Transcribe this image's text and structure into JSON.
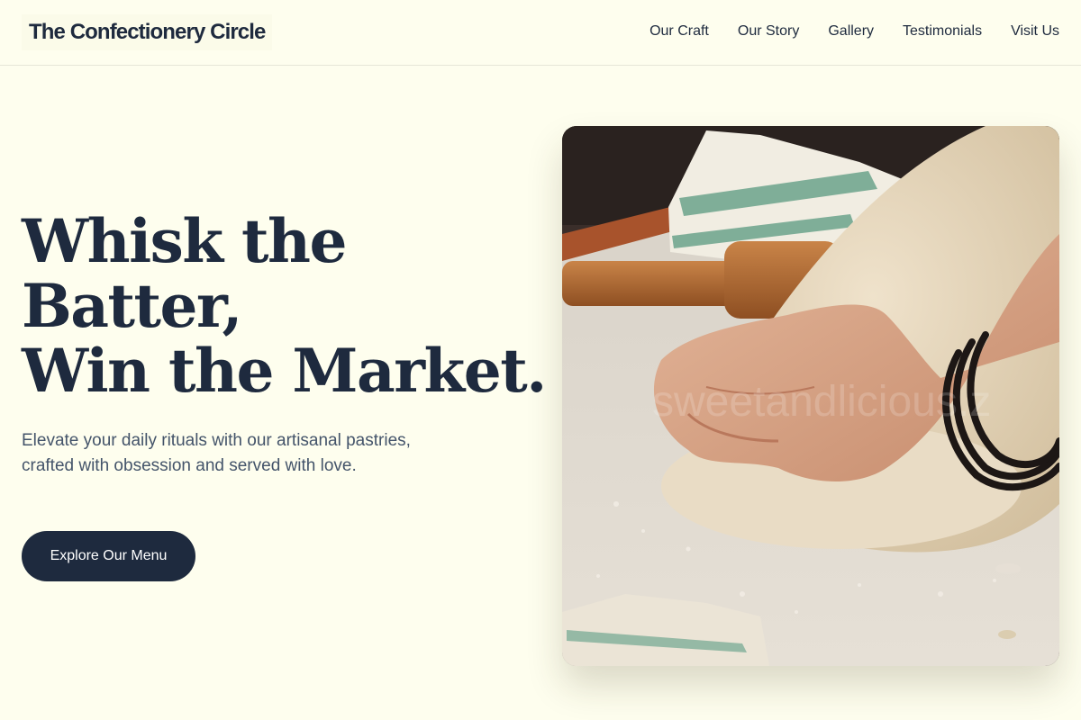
{
  "header": {
    "brand": "The Confectionery Circle",
    "nav": [
      {
        "label": "Our Craft"
      },
      {
        "label": "Our Story"
      },
      {
        "label": "Gallery"
      },
      {
        "label": "Testimonials"
      },
      {
        "label": "Visit Us"
      }
    ]
  },
  "hero": {
    "title_lines": [
      "Whisk the",
      "Batter,",
      "Win the Market."
    ],
    "subtitle": "Elevate your daily rituals with our artisanal pastries, crafted with obsession and served with love.",
    "cta_label": "Explore Our Menu"
  },
  "photo": {
    "watermark": "sweetandlicious.z"
  },
  "colors": {
    "background": "#fefeee",
    "text_primary": "#1e2a3e",
    "text_secondary": "#44546a",
    "cta_bg": "#1e2a3e",
    "cta_text": "#ffffff"
  }
}
